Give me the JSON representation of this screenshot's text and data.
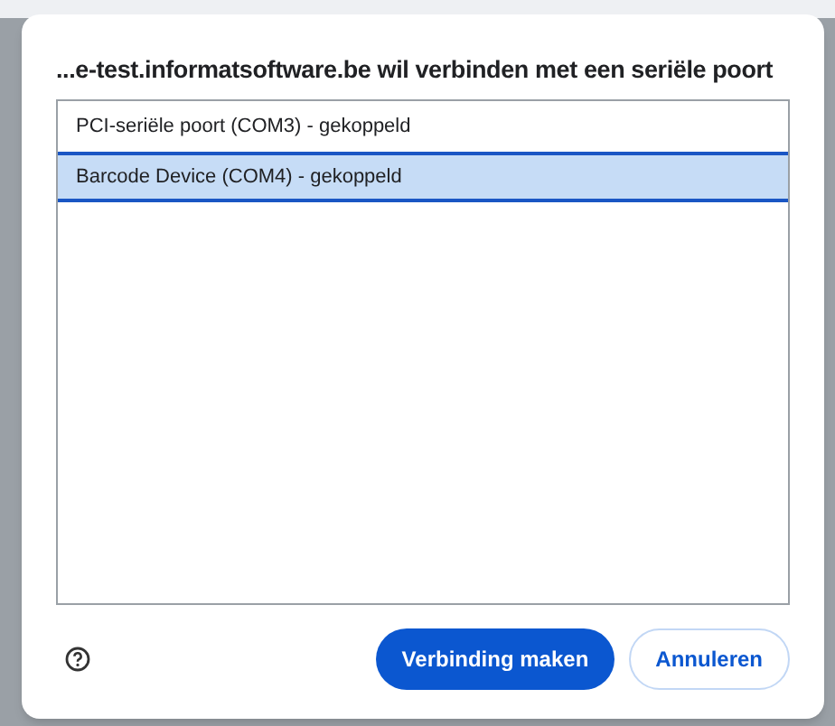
{
  "dialog": {
    "title": "...e-test.informatsoftware.be wil verbinden met een seriële poort"
  },
  "ports": [
    {
      "label": "PCI-seriële poort (COM3) - gekoppeld",
      "selected": false
    },
    {
      "label": "Barcode Device (COM4) - gekoppeld",
      "selected": true
    }
  ],
  "buttons": {
    "primary": "Verbinding maken",
    "secondary": "Annuleren"
  }
}
